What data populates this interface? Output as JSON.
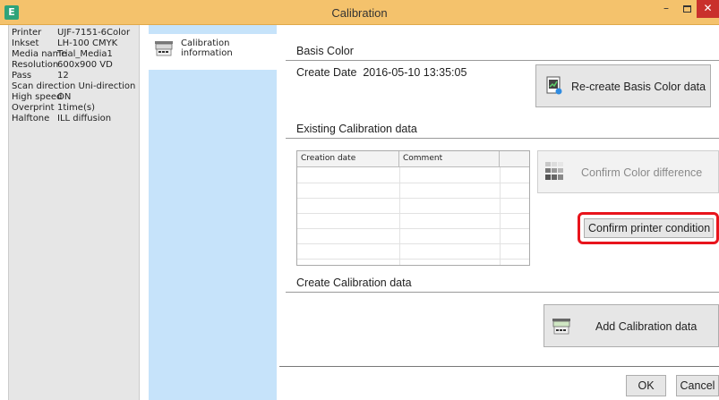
{
  "window": {
    "title": "Calibration",
    "app_icon": "E",
    "minimize_glyph": "–",
    "close_glyph": "✕"
  },
  "printer_info": [
    {
      "key": "Printer",
      "value": "UJF-7151-6Color"
    },
    {
      "key": "Inkset",
      "value": "LH-100 CMYK"
    },
    {
      "key": "Media name",
      "value": "Trial_Media1"
    },
    {
      "key": "Resolution",
      "value": "600x900 VD"
    },
    {
      "key": "Pass",
      "value": "12"
    },
    {
      "key": "Scan direction",
      "value": "Uni-direction"
    },
    {
      "key": "High speed",
      "value": "ON"
    },
    {
      "key": "Overprint",
      "value": "1time(s)"
    },
    {
      "key": "Halftone",
      "value": "ILL diffusion"
    }
  ],
  "nav": {
    "items": [
      {
        "label": "Calibration information",
        "icon": "printer-icon"
      }
    ]
  },
  "basis_color": {
    "heading": "Basis Color",
    "create_date_label": "Create Date",
    "create_date_value": "2016-05-10 13:35:05",
    "recreate_button": "Re-create Basis Color data"
  },
  "existing": {
    "heading": "Existing Calibration data",
    "columns": [
      "Creation date",
      "Comment",
      ""
    ],
    "confirm_color_button": "Confirm Color difference",
    "confirm_printer_button": "Confirm printer condition"
  },
  "create": {
    "heading": "Create Calibration data",
    "add_button": "Add Calibration data"
  },
  "footer": {
    "ok_label": "OK",
    "cancel_label": "Cancel"
  },
  "colors": {
    "title_bar": "#f4c26c",
    "nav_panel": "#c6e3fa",
    "highlight": "#e8141c"
  }
}
